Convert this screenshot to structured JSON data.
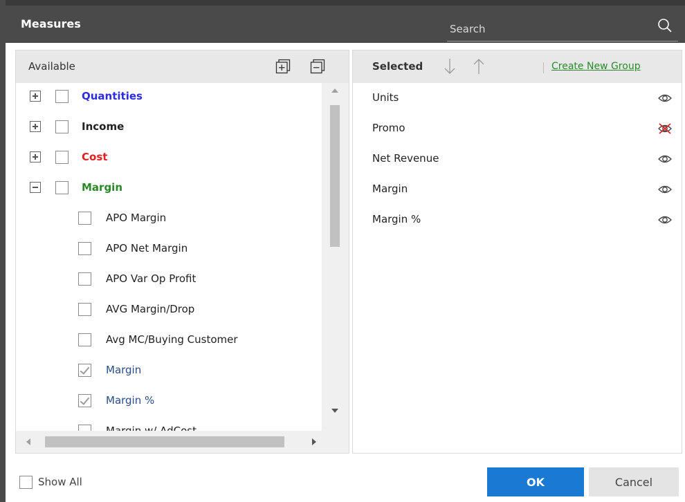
{
  "header": {
    "title": "Measures",
    "search_placeholder": "Search"
  },
  "available": {
    "label": "Available",
    "rows": [
      {
        "kind": "group",
        "label": "Quantities",
        "color": "#2d2de0",
        "expander": "plus",
        "checked": false
      },
      {
        "kind": "group",
        "label": "Income",
        "color": "#222222",
        "expander": "plus",
        "checked": false
      },
      {
        "kind": "group",
        "label": "Cost",
        "color": "#e02020",
        "expander": "plus",
        "checked": false
      },
      {
        "kind": "group",
        "label": "Margin",
        "color": "#2a8a2a",
        "expander": "minus",
        "checked": false
      },
      {
        "kind": "item",
        "label": "APO Margin",
        "checked": false
      },
      {
        "kind": "item",
        "label": "APO Net Margin",
        "checked": false
      },
      {
        "kind": "item",
        "label": "APO Var Op Profit",
        "checked": false
      },
      {
        "kind": "item",
        "label": "AVG Margin/Drop",
        "checked": false
      },
      {
        "kind": "item",
        "label": "Avg MC/Buying Customer",
        "checked": false
      },
      {
        "kind": "item",
        "label": "Margin",
        "checked": true
      },
      {
        "kind": "item",
        "label": "Margin %",
        "checked": true
      },
      {
        "kind": "item",
        "label": "Margin w/ AdCost",
        "checked": false
      }
    ]
  },
  "selected": {
    "label": "Selected",
    "create_group_label": "Create New Group",
    "items": [
      {
        "label": "Units",
        "visible": true
      },
      {
        "label": "Promo",
        "visible": false
      },
      {
        "label": "Net Revenue",
        "visible": true
      },
      {
        "label": "Margin",
        "visible": true
      },
      {
        "label": "Margin %",
        "visible": true
      }
    ]
  },
  "footer": {
    "show_all_label": "Show All",
    "ok_label": "OK",
    "cancel_label": "Cancel"
  }
}
